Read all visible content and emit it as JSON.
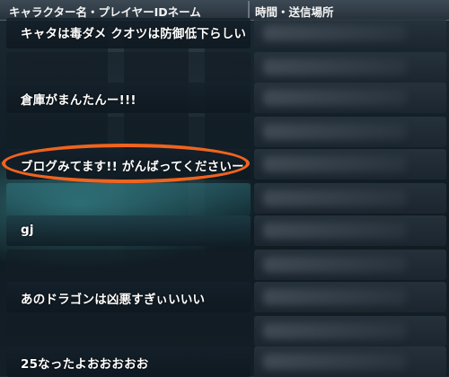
{
  "header": {
    "col_name": "キャラクター名・プレイヤーIDネーム",
    "col_time": "時間・送信場所"
  },
  "messages": [
    {
      "text": "キャタは毒ダメ クオツは防御低下らしい"
    },
    {
      "text": "倉庫がまんたんー!!!"
    },
    {
      "text": "ブログみてます!! がんばってくださいー",
      "highlighted": true
    },
    {
      "text": "gj"
    },
    {
      "text": "あのドラゴンは凶悪すぎぃいいい"
    },
    {
      "text": "25なったよおおおおお"
    }
  ],
  "colors": {
    "highlight": "#f0641e",
    "header_bg": "#2e3a44"
  }
}
